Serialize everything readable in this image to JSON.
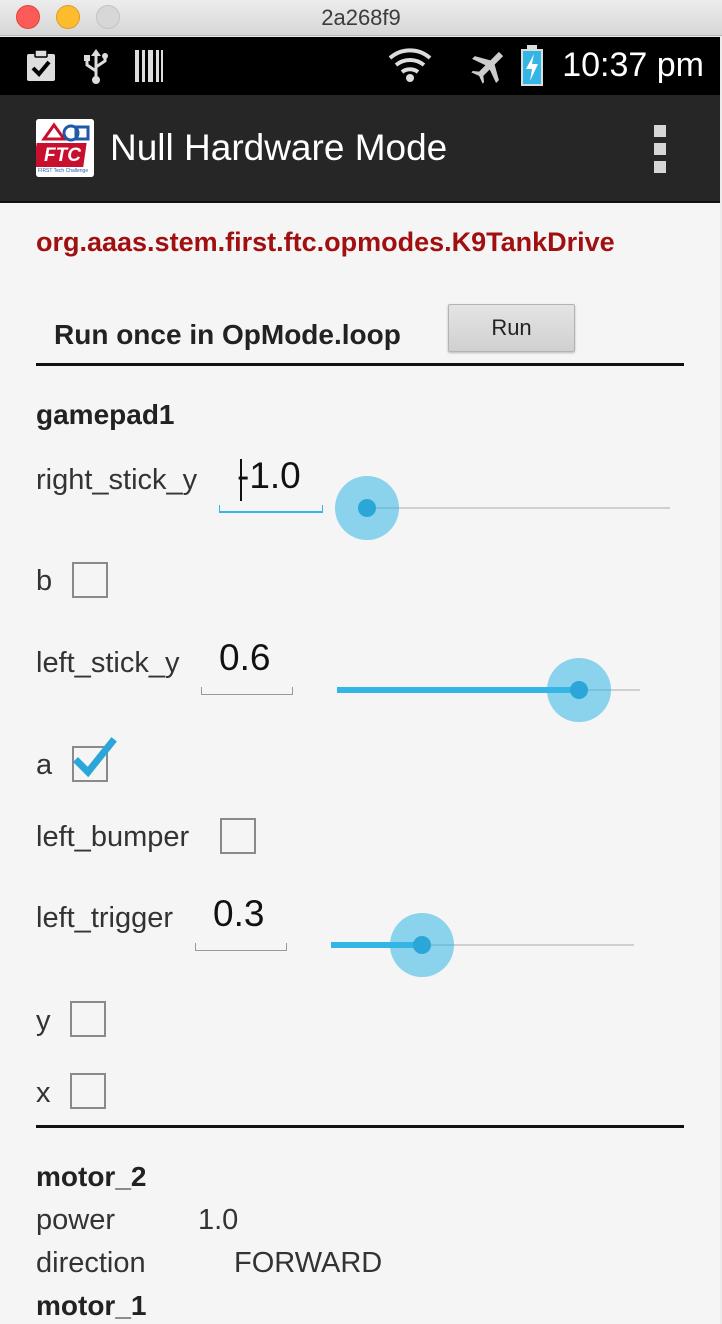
{
  "window": {
    "title": "2a268f9"
  },
  "status_bar": {
    "time": "10:37 pm",
    "icons": [
      "clipboard-check-icon",
      "usb-icon",
      "barcode-icon",
      "wifi-icon",
      "airplane-icon",
      "battery-charging-icon"
    ]
  },
  "action_bar": {
    "title": "Null Hardware Mode",
    "logo_text": "FTC",
    "logo_sub": "FIRST Tech Challenge"
  },
  "opmode": {
    "name": "org.aaas.stem.first.ftc.opmodes.K9TankDrive"
  },
  "run_once": {
    "label": "Run once in OpMode.loop",
    "button": "Run"
  },
  "gamepad": {
    "title": "gamepad1",
    "right_stick_y": {
      "label": "right_stick_y",
      "value": "-1.0",
      "slider": -1.0
    },
    "b": {
      "label": "b",
      "checked": false
    },
    "left_stick_y": {
      "label": "left_stick_y",
      "value": "0.6",
      "slider": 0.6
    },
    "a": {
      "label": "a",
      "checked": true
    },
    "left_bumper": {
      "label": "left_bumper",
      "checked": false
    },
    "left_trigger": {
      "label": "left_trigger",
      "value": "0.3",
      "slider": 0.3
    },
    "y": {
      "label": "y",
      "checked": false
    },
    "x": {
      "label": "x",
      "checked": false
    }
  },
  "motors": [
    {
      "name": "motor_2",
      "power_label": "power",
      "power": "1.0",
      "direction_label": "direction",
      "direction": "FORWARD"
    },
    {
      "name": "motor_1"
    }
  ],
  "colors": {
    "accent": "#33b5e5",
    "opmode_text": "#a11010",
    "action_bar": "#262626"
  }
}
